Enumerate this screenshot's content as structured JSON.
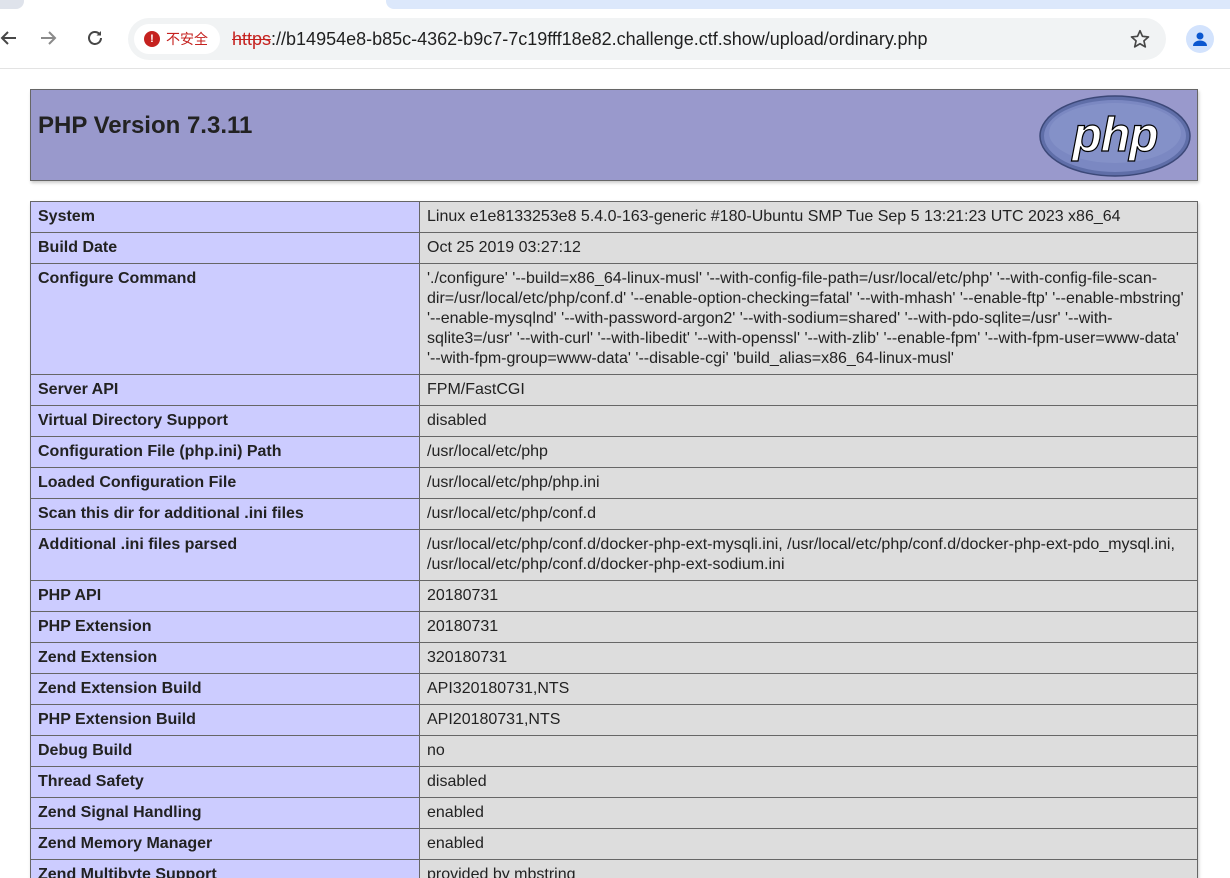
{
  "browser": {
    "security_label": "不安全",
    "url_scheme": "https",
    "url_rest": "://b14954e8-b85c-4362-b9c7-7c19fff18e82.challenge.ctf.show/upload/ordinary.php",
    "icons": {
      "back": "arrow-left-icon",
      "forward": "arrow-right-icon",
      "reload": "reload-icon",
      "bookmark": "star-icon",
      "profile": "person-icon",
      "warning": "warning-icon"
    },
    "colors": {
      "insecure": "#c5221f",
      "omnibox": "#f1f3f4"
    }
  },
  "phpinfo": {
    "title": "PHP Version 7.3.11",
    "logo_text": "php",
    "colors": {
      "header": "#9999cc",
      "key_cell": "#ccccff",
      "value_cell": "#dddddd"
    },
    "rows": [
      {
        "key": "System",
        "value": "Linux e1e8133253e8 5.4.0-163-generic #180-Ubuntu SMP Tue Sep 5 13:21:23 UTC 2023 x86_64"
      },
      {
        "key": "Build Date",
        "value": "Oct 25 2019 03:27:12"
      },
      {
        "key": "Configure Command",
        "value": "'./configure' '--build=x86_64-linux-musl' '--with-config-file-path=/usr/local/etc/php' '--with-config-file-scan-dir=/usr/local/etc/php/conf.d' '--enable-option-checking=fatal' '--with-mhash' '--enable-ftp' '--enable-mbstring' '--enable-mysqlnd' '--with-password-argon2' '--with-sodium=shared' '--with-pdo-sqlite=/usr' '--with-sqlite3=/usr' '--with-curl' '--with-libedit' '--with-openssl' '--with-zlib' '--enable-fpm' '--with-fpm-user=www-data' '--with-fpm-group=www-data' '--disable-cgi' 'build_alias=x86_64-linux-musl'"
      },
      {
        "key": "Server API",
        "value": "FPM/FastCGI"
      },
      {
        "key": "Virtual Directory Support",
        "value": "disabled"
      },
      {
        "key": "Configuration File (php.ini) Path",
        "value": "/usr/local/etc/php"
      },
      {
        "key": "Loaded Configuration File",
        "value": "/usr/local/etc/php/php.ini"
      },
      {
        "key": "Scan this dir for additional .ini files",
        "value": "/usr/local/etc/php/conf.d"
      },
      {
        "key": "Additional .ini files parsed",
        "value": "/usr/local/etc/php/conf.d/docker-php-ext-mysqli.ini, /usr/local/etc/php/conf.d/docker-php-ext-pdo_mysql.ini, /usr/local/etc/php/conf.d/docker-php-ext-sodium.ini"
      },
      {
        "key": "PHP API",
        "value": "20180731"
      },
      {
        "key": "PHP Extension",
        "value": "20180731"
      },
      {
        "key": "Zend Extension",
        "value": "320180731"
      },
      {
        "key": "Zend Extension Build",
        "value": "API320180731,NTS"
      },
      {
        "key": "PHP Extension Build",
        "value": "API20180731,NTS"
      },
      {
        "key": "Debug Build",
        "value": "no"
      },
      {
        "key": "Thread Safety",
        "value": "disabled"
      },
      {
        "key": "Zend Signal Handling",
        "value": "enabled"
      },
      {
        "key": "Zend Memory Manager",
        "value": "enabled"
      },
      {
        "key": "Zend Multibyte Support",
        "value": "provided by mbstring"
      }
    ]
  }
}
